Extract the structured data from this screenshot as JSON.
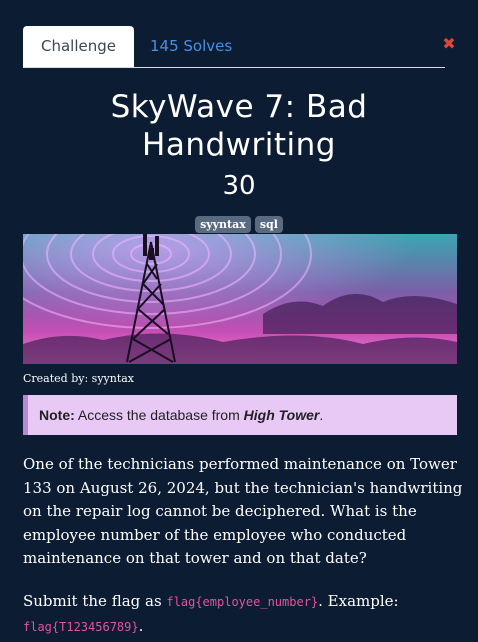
{
  "tabs": {
    "active": "Challenge",
    "solves": "145 Solves"
  },
  "challenge": {
    "title": "SkyWave 7: Bad Handwriting",
    "points": "30",
    "tags": [
      "syyntax",
      "sql"
    ],
    "created_by": "Created by: syyntax"
  },
  "note": {
    "label": "Note:",
    "text_before": " Access the database from ",
    "location": "High Tower",
    "text_after": "."
  },
  "description": "One of the technicians performed maintenance on Tower 133 on August 26, 2024, but the technician's handwriting on the repair log cannot be deciphered. What is the employee number of the employee who conducted maintenance on that tower and on that date?",
  "submit": {
    "prefix": "Submit the flag as ",
    "flag_format": "flag{employee_number}",
    "middle": ". Example: ",
    "example": "flag{T123456789}",
    "suffix": "."
  },
  "colors": {
    "background": "#0b1c33",
    "tab_link": "#4a90e2",
    "note_bg": "#e8c9f6",
    "code": "#e0569b",
    "close": "#d9473f"
  },
  "icons": {
    "close": "close-icon"
  }
}
